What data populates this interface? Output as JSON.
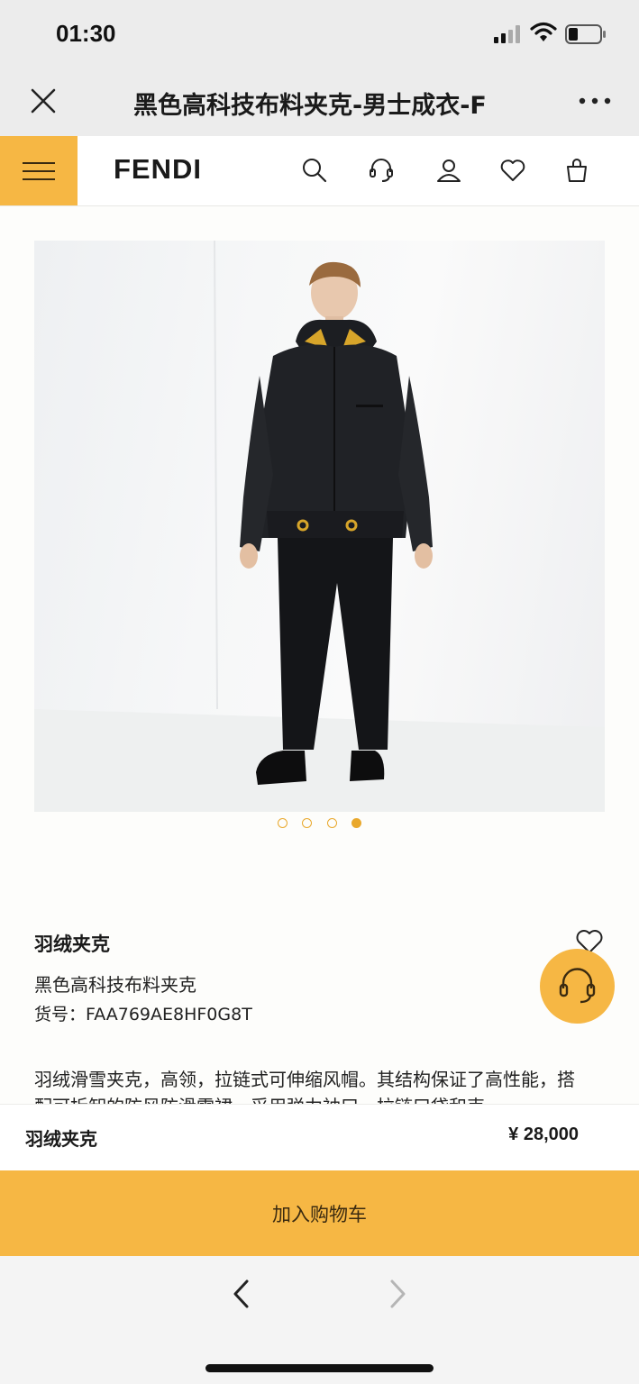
{
  "status_bar": {
    "time": "01:30"
  },
  "title_bar": {
    "title": "黑色高科技布料夹克-男士成衣-F"
  },
  "nav": {
    "brand": "FENDI",
    "icons": [
      "search-icon",
      "customer-service-icon",
      "account-icon",
      "wishlist-icon",
      "shopping-bag-icon"
    ]
  },
  "gallery": {
    "total_images": 4,
    "active_index": 3
  },
  "product": {
    "category": "羽绒夹克",
    "name": "黑色高科技布料夹克",
    "sku_label": "货号：",
    "sku": "FAA769AE8HF0G8T",
    "description": "羽绒滑雪夹克，高领，拉链式可伸缩风帽。其结构保证了高性能，搭配可拆卸的防风防滑雪裙，采用弹力袖口，拉链口袋和束"
  },
  "price_bar": {
    "name": "羽绒夹克",
    "price": "¥  28,000"
  },
  "cart": {
    "label": "加入购物车"
  },
  "colors": {
    "accent": "#f6b744",
    "dot": "#e9a82c",
    "bar_bg": "#ececec"
  }
}
